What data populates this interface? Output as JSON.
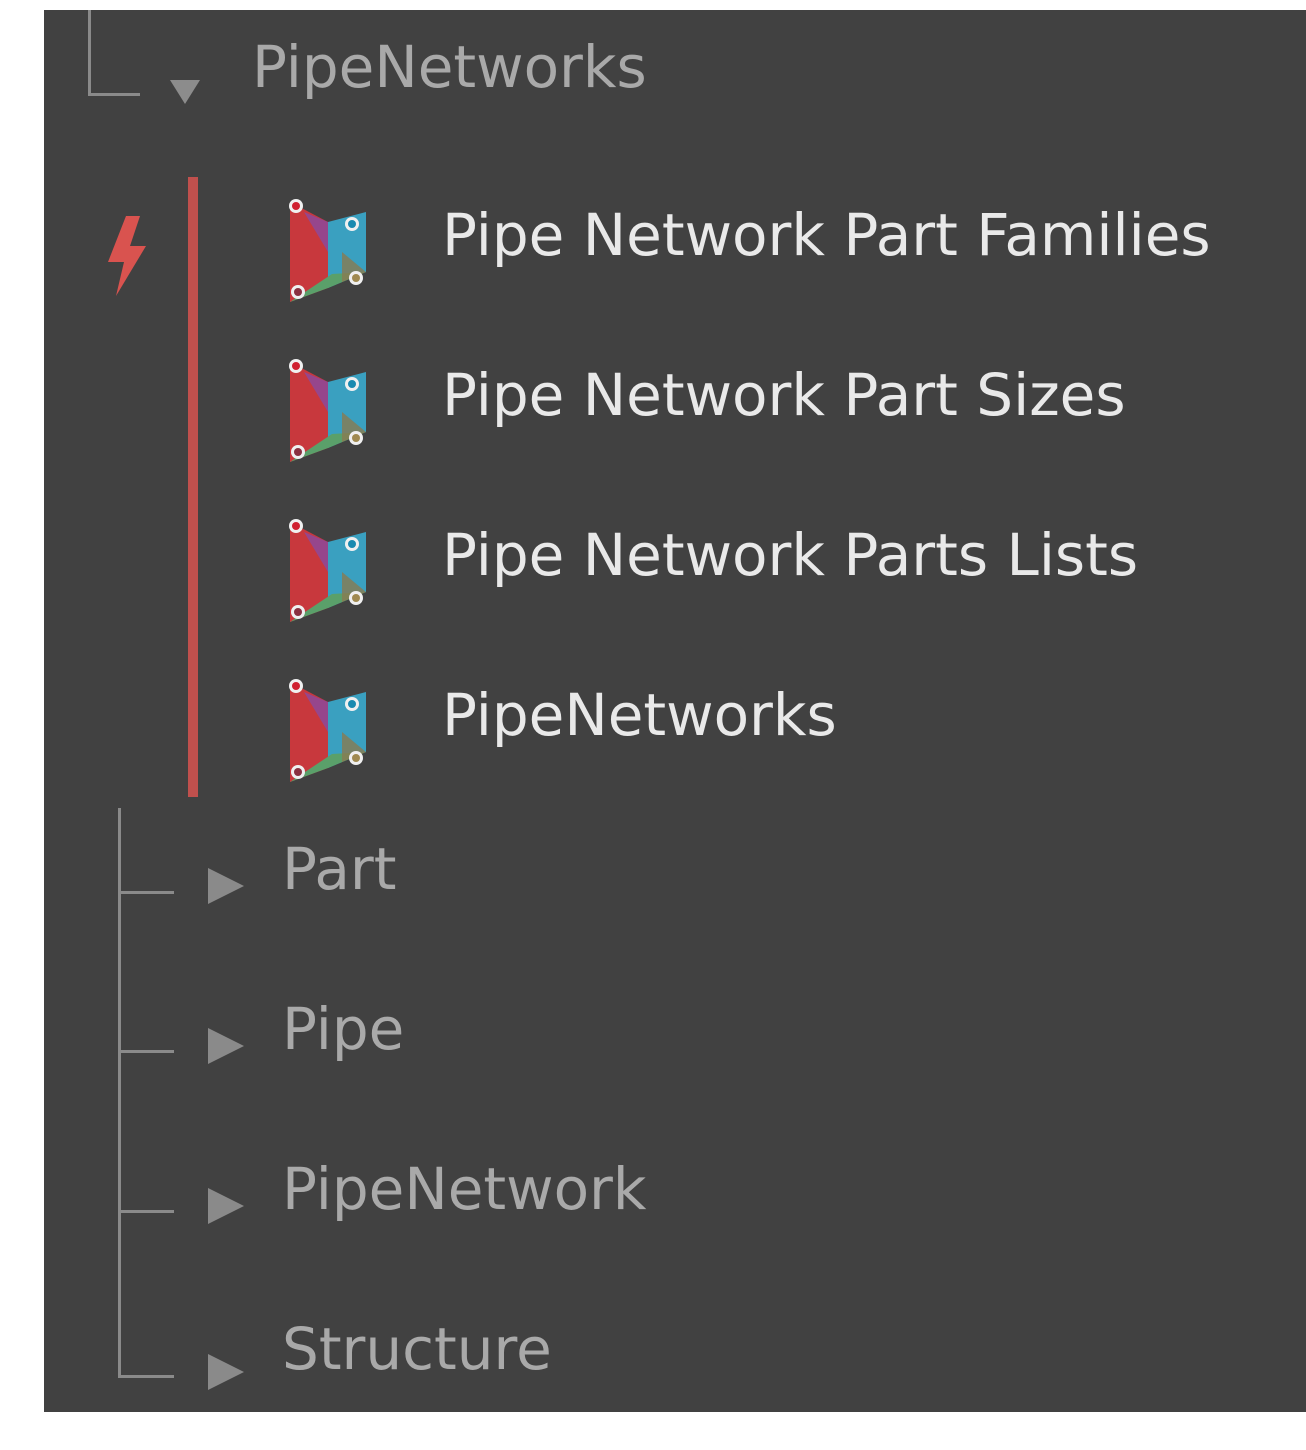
{
  "tree": {
    "parent": {
      "label": "PipeNetworks",
      "expanded": true
    },
    "nodes": [
      {
        "label": "Pipe Network Part Families",
        "icon": "dynamo-node-icon"
      },
      {
        "label": "Pipe Network Part Sizes",
        "icon": "dynamo-node-icon"
      },
      {
        "label": "Pipe Network Parts Lists",
        "icon": "dynamo-node-icon"
      },
      {
        "label": "PipeNetworks",
        "icon": "dynamo-node-icon"
      }
    ],
    "categories": [
      {
        "label": "Part",
        "expanded": false
      },
      {
        "label": "Pipe",
        "expanded": false
      },
      {
        "label": "PipeNetwork",
        "expanded": false
      },
      {
        "label": "Structure",
        "expanded": false
      }
    ],
    "action_icon": "lightning-bolt-icon"
  },
  "colors": {
    "panel_background": "#414141",
    "accent": "#c0504d",
    "category_text": "#a9a9a9",
    "node_text": "#e9e9e9"
  }
}
